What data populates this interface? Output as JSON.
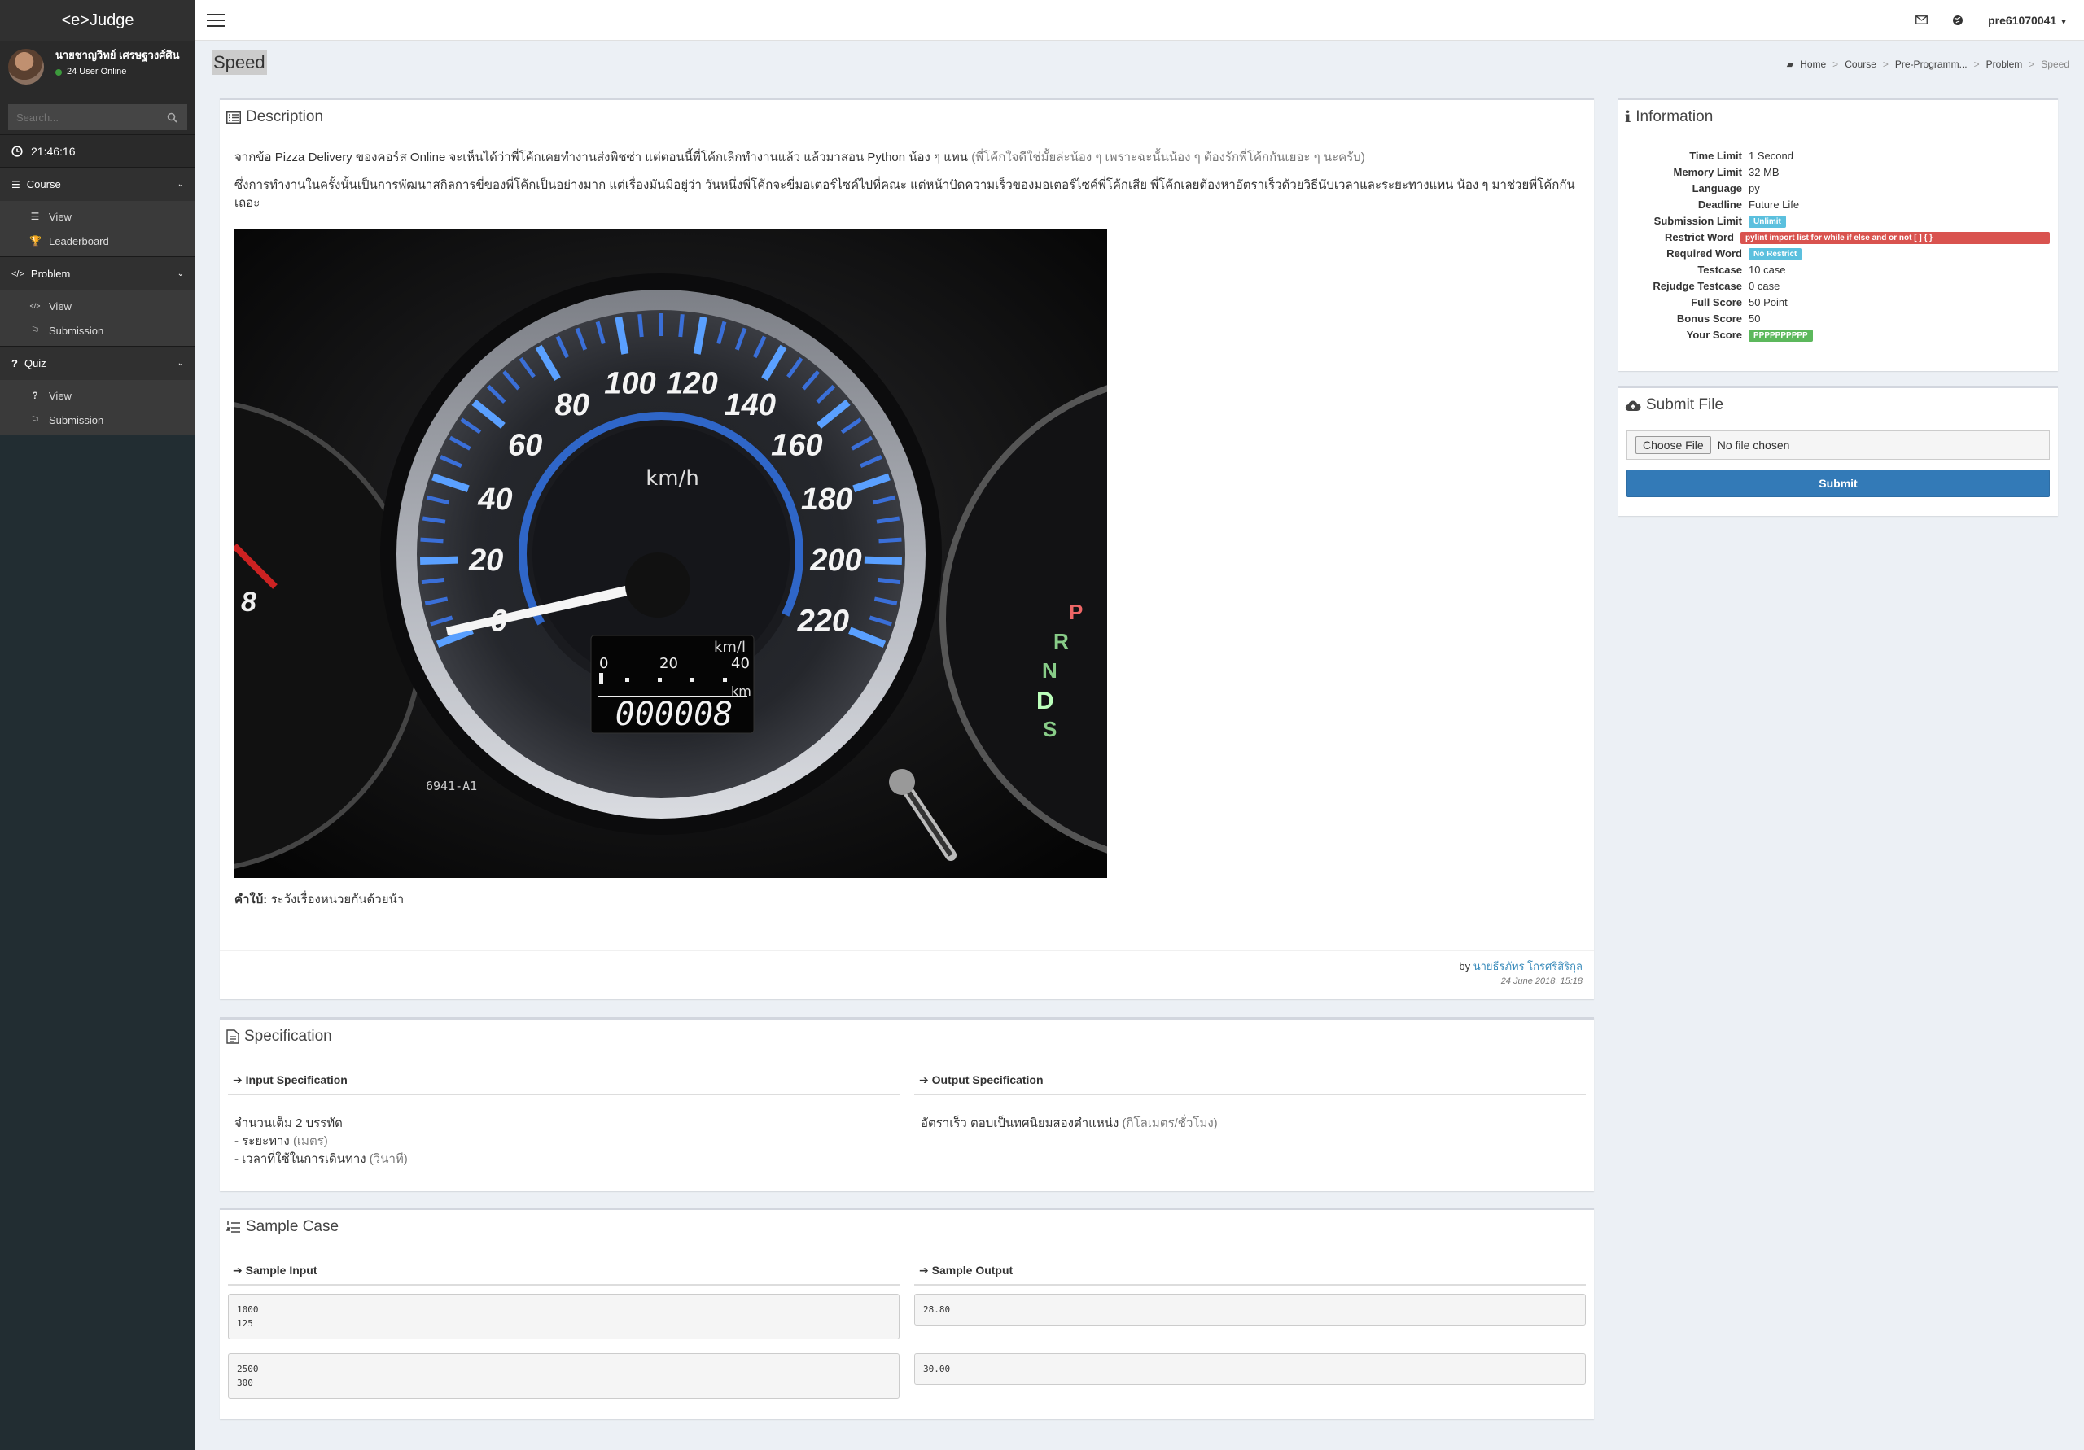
{
  "app": {
    "logo": "<e>Judge"
  },
  "user": {
    "name": "นายชาญวิทย์ เศรษฐวงศ์ศิน",
    "online": "24 User Online"
  },
  "search": {
    "placeholder": "Search..."
  },
  "clock": "21:46:16",
  "nav": [
    {
      "label": "Course",
      "items": [
        {
          "label": "View"
        },
        {
          "label": "Leaderboard"
        }
      ]
    },
    {
      "label": "Problem",
      "items": [
        {
          "label": "View"
        },
        {
          "label": "Submission"
        }
      ]
    },
    {
      "label": "Quiz",
      "items": [
        {
          "label": "View"
        },
        {
          "label": "Submission"
        }
      ]
    }
  ],
  "topbar": {
    "username": "pre61070041"
  },
  "page": {
    "title": "Speed"
  },
  "breadcrumb": [
    "Home",
    "Course",
    "Pre-Programm...",
    "Problem",
    "Speed"
  ],
  "description": {
    "title": "Description",
    "p1": "จากข้อ Pizza Delivery ของคอร์ส Online จะเห็นได้ว่าพี่โค้กเคยทำงานส่งพิชซ่า แต่ตอนนี้พี่โค้กเลิกทำงานแล้ว แล้วมาสอน Python น้อง ๆ แทน",
    "p1_muted": "(พี่โค้กใจดีใช่มั้ยล่ะน้อง ๆ เพราะฉะนั้นน้อง ๆ ต้องรักพี่โค้กกันเยอะ ๆ นะครับ)",
    "p2": "ซึ่งการทำงานในครั้งนั้นเป็นการพัฒนาสกิลการขี่ของพี่โค้กเป็นอย่างมาก แต่เรื่องมันมีอยู่ว่า วันหนึ่งพี่โค้กจะขี่มอเตอร์ไซค์ไปที่คณะ แต่หน้าปัดความเร็วของมอเตอร์ไซค์พี่โค้กเสีย พี่โค้กเลยต้องหาอัตราเร็วด้วยวิธีนับเวลาและระยะทางแทน น้อง ๆ มาช่วยพี่โค้กกันเถอะ",
    "hint_label": "คำใบ้:",
    "hint": "ระวังเรื่องหน่วยกันด้วยน้า",
    "author_prefix": "by",
    "author": "นายธีรภัทร โกรศรีสิริกุล",
    "date": "24 June 2018, 15:18",
    "gauge": {
      "speed_labels": [
        "0",
        "20",
        "40",
        "60",
        "80",
        "100",
        "120",
        "140",
        "160",
        "180",
        "200",
        "220"
      ],
      "unit": "km/h",
      "fuel_unit": "km/l",
      "fuel_ticks": [
        "0",
        "20",
        "40"
      ],
      "odo_unit": "km",
      "odometer": "000008",
      "part_no": "6941-A1",
      "left_digit": "8",
      "gear": [
        "P",
        "R",
        "N",
        "D",
        "S"
      ]
    }
  },
  "specification": {
    "title": "Specification",
    "input_title": "Input Specification",
    "output_title": "Output Specification",
    "input_lines": [
      "จำนวนเต็ม 2 บรรทัด",
      "- ระยะทาง",
      "- เวลาที่ใช้ในการเดินทาง"
    ],
    "input_units": [
      "(เมตร)",
      "(วินาที)"
    ],
    "output_text": "อัตราเร็ว ตอบเป็นทศนิยมสองตำแหน่ง",
    "output_unit": "(กิโลเมตร/ชั่วโมง)"
  },
  "sample": {
    "title": "Sample Case",
    "input_title": "Sample Input",
    "output_title": "Sample Output",
    "cases": [
      {
        "input": "1000\n125",
        "output": "28.80"
      },
      {
        "input": "2500\n300",
        "output": "30.00"
      }
    ]
  },
  "information": {
    "title": "Information",
    "rows": [
      {
        "key": "Time Limit",
        "value": "1 Second"
      },
      {
        "key": "Memory Limit",
        "value": "32 MB"
      },
      {
        "key": "Language",
        "value": "py"
      },
      {
        "key": "Deadline",
        "value": "Future Life"
      },
      {
        "key": "Submission Limit",
        "badge": "Unlimit"
      },
      {
        "key": "Restrict Word",
        "badge": "pylint import list for while if else and or not [ ] { }"
      },
      {
        "key": "Required Word",
        "badge": "No Restrict"
      },
      {
        "key": "Testcase",
        "value": "10 case"
      },
      {
        "key": "Rejudge Testcase",
        "value": "0 case"
      },
      {
        "key": "Full Score",
        "value": "50 Point"
      },
      {
        "key": "Bonus Score",
        "value": "50"
      },
      {
        "key": "Your Score",
        "badge": "PPPPPPPPPP"
      }
    ]
  },
  "submit": {
    "title": "Submit File",
    "choose": "Choose File",
    "no_file": "No file chosen",
    "button": "Submit"
  }
}
